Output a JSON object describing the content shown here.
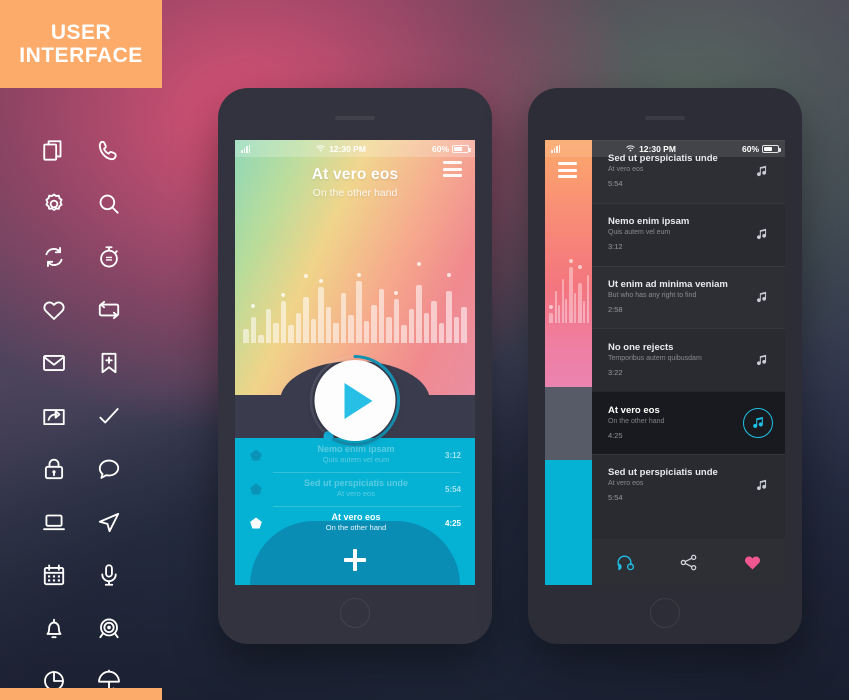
{
  "panel": {
    "line1": "USER",
    "line2": "INTERFACE"
  },
  "icons": [
    {
      "name": "copy-icon"
    },
    {
      "name": "phone-icon"
    },
    {
      "name": "gear-icon"
    },
    {
      "name": "search-icon"
    },
    {
      "name": "refresh-icon"
    },
    {
      "name": "stopwatch-icon"
    },
    {
      "name": "heart-icon"
    },
    {
      "name": "repeat-icon"
    },
    {
      "name": "mail-icon"
    },
    {
      "name": "bookmark-add-icon"
    },
    {
      "name": "share-folder-icon"
    },
    {
      "name": "check-icon"
    },
    {
      "name": "lock-icon"
    },
    {
      "name": "chat-bubble-icon"
    },
    {
      "name": "laptop-icon"
    },
    {
      "name": "send-icon"
    },
    {
      "name": "calendar-icon"
    },
    {
      "name": "microphone-icon"
    },
    {
      "name": "bell-icon"
    },
    {
      "name": "target-icon"
    },
    {
      "name": "pie-chart-icon"
    },
    {
      "name": "umbrella-icon"
    }
  ],
  "status_bar": {
    "time": "12:30 PM",
    "battery_percent": "60%"
  },
  "phone1": {
    "now_playing": {
      "title": "At vero eos",
      "subtitle": "On the other hand"
    },
    "controls": {
      "play": "play-button",
      "previous": "previous-button",
      "next": "next-button"
    },
    "actions": [
      {
        "name": "headphones-icon"
      },
      {
        "name": "share-icon"
      },
      {
        "name": "heart-icon"
      }
    ],
    "playlist": [
      {
        "title": "Nemo enim ipsam",
        "subtitle": "Quis autem vel eum",
        "duration": "3:12",
        "active": false
      },
      {
        "title": "Sed ut perspiciatis unde",
        "subtitle": "At vero eos",
        "duration": "5:54",
        "active": false
      },
      {
        "title": "At vero eos",
        "subtitle": "On the other hand",
        "duration": "4:25",
        "active": true
      }
    ],
    "add_label": "add-button"
  },
  "phone2": {
    "tracks": [
      {
        "title": "Sed ut perspiciatis unde",
        "subtitle": "At vero eos",
        "duration": "5:54",
        "active": false
      },
      {
        "title": "Nemo enim ipsam",
        "subtitle": "Quis autem vel eum",
        "duration": "3:12",
        "active": false
      },
      {
        "title": "Ut enim ad minima veniam",
        "subtitle": "But who has any right to find",
        "duration": "2:58",
        "active": false
      },
      {
        "title": "No one rejects",
        "subtitle": "Temporibus autem quibusdam",
        "duration": "3:22",
        "active": false
      },
      {
        "title": "At vero eos",
        "subtitle": "On the other hand",
        "duration": "4:25",
        "active": true
      },
      {
        "title": "Sed ut perspiciatis unde",
        "subtitle": "At vero eos",
        "duration": "5:54",
        "active": false
      }
    ],
    "toolbar": [
      {
        "name": "headphones-icon"
      },
      {
        "name": "share-icon"
      },
      {
        "name": "heart-icon"
      }
    ]
  },
  "colors": {
    "panel_orange": "#fcab6b",
    "cyan": "#06b2d4",
    "accent_cyan": "#1fc0e6",
    "heart_pink": "#f0568f",
    "player_dark": "#3a3b4d",
    "list_dark": "#2a2b31",
    "active_row": "#191a1f"
  },
  "equalizer": {
    "phone1_bars": [
      14,
      26,
      8,
      34,
      20,
      42,
      18,
      30,
      46,
      24,
      56,
      36,
      20,
      50,
      28,
      62,
      22,
      38,
      54,
      26,
      44,
      18,
      34,
      58,
      30,
      42,
      20,
      52,
      26,
      36
    ],
    "phone1_dots": [
      0,
      1,
      0,
      0,
      0,
      1,
      0,
      0,
      1,
      0,
      1,
      0,
      0,
      0,
      0,
      1,
      0,
      0,
      0,
      0,
      1,
      0,
      0,
      1,
      0,
      0,
      0,
      1,
      0,
      0
    ],
    "phone2_bars": [
      10,
      32,
      18,
      44,
      24,
      56,
      30,
      40,
      22,
      48
    ],
    "phone2_dots": [
      1,
      0,
      0,
      0,
      0,
      1,
      0,
      1,
      0,
      0
    ]
  }
}
